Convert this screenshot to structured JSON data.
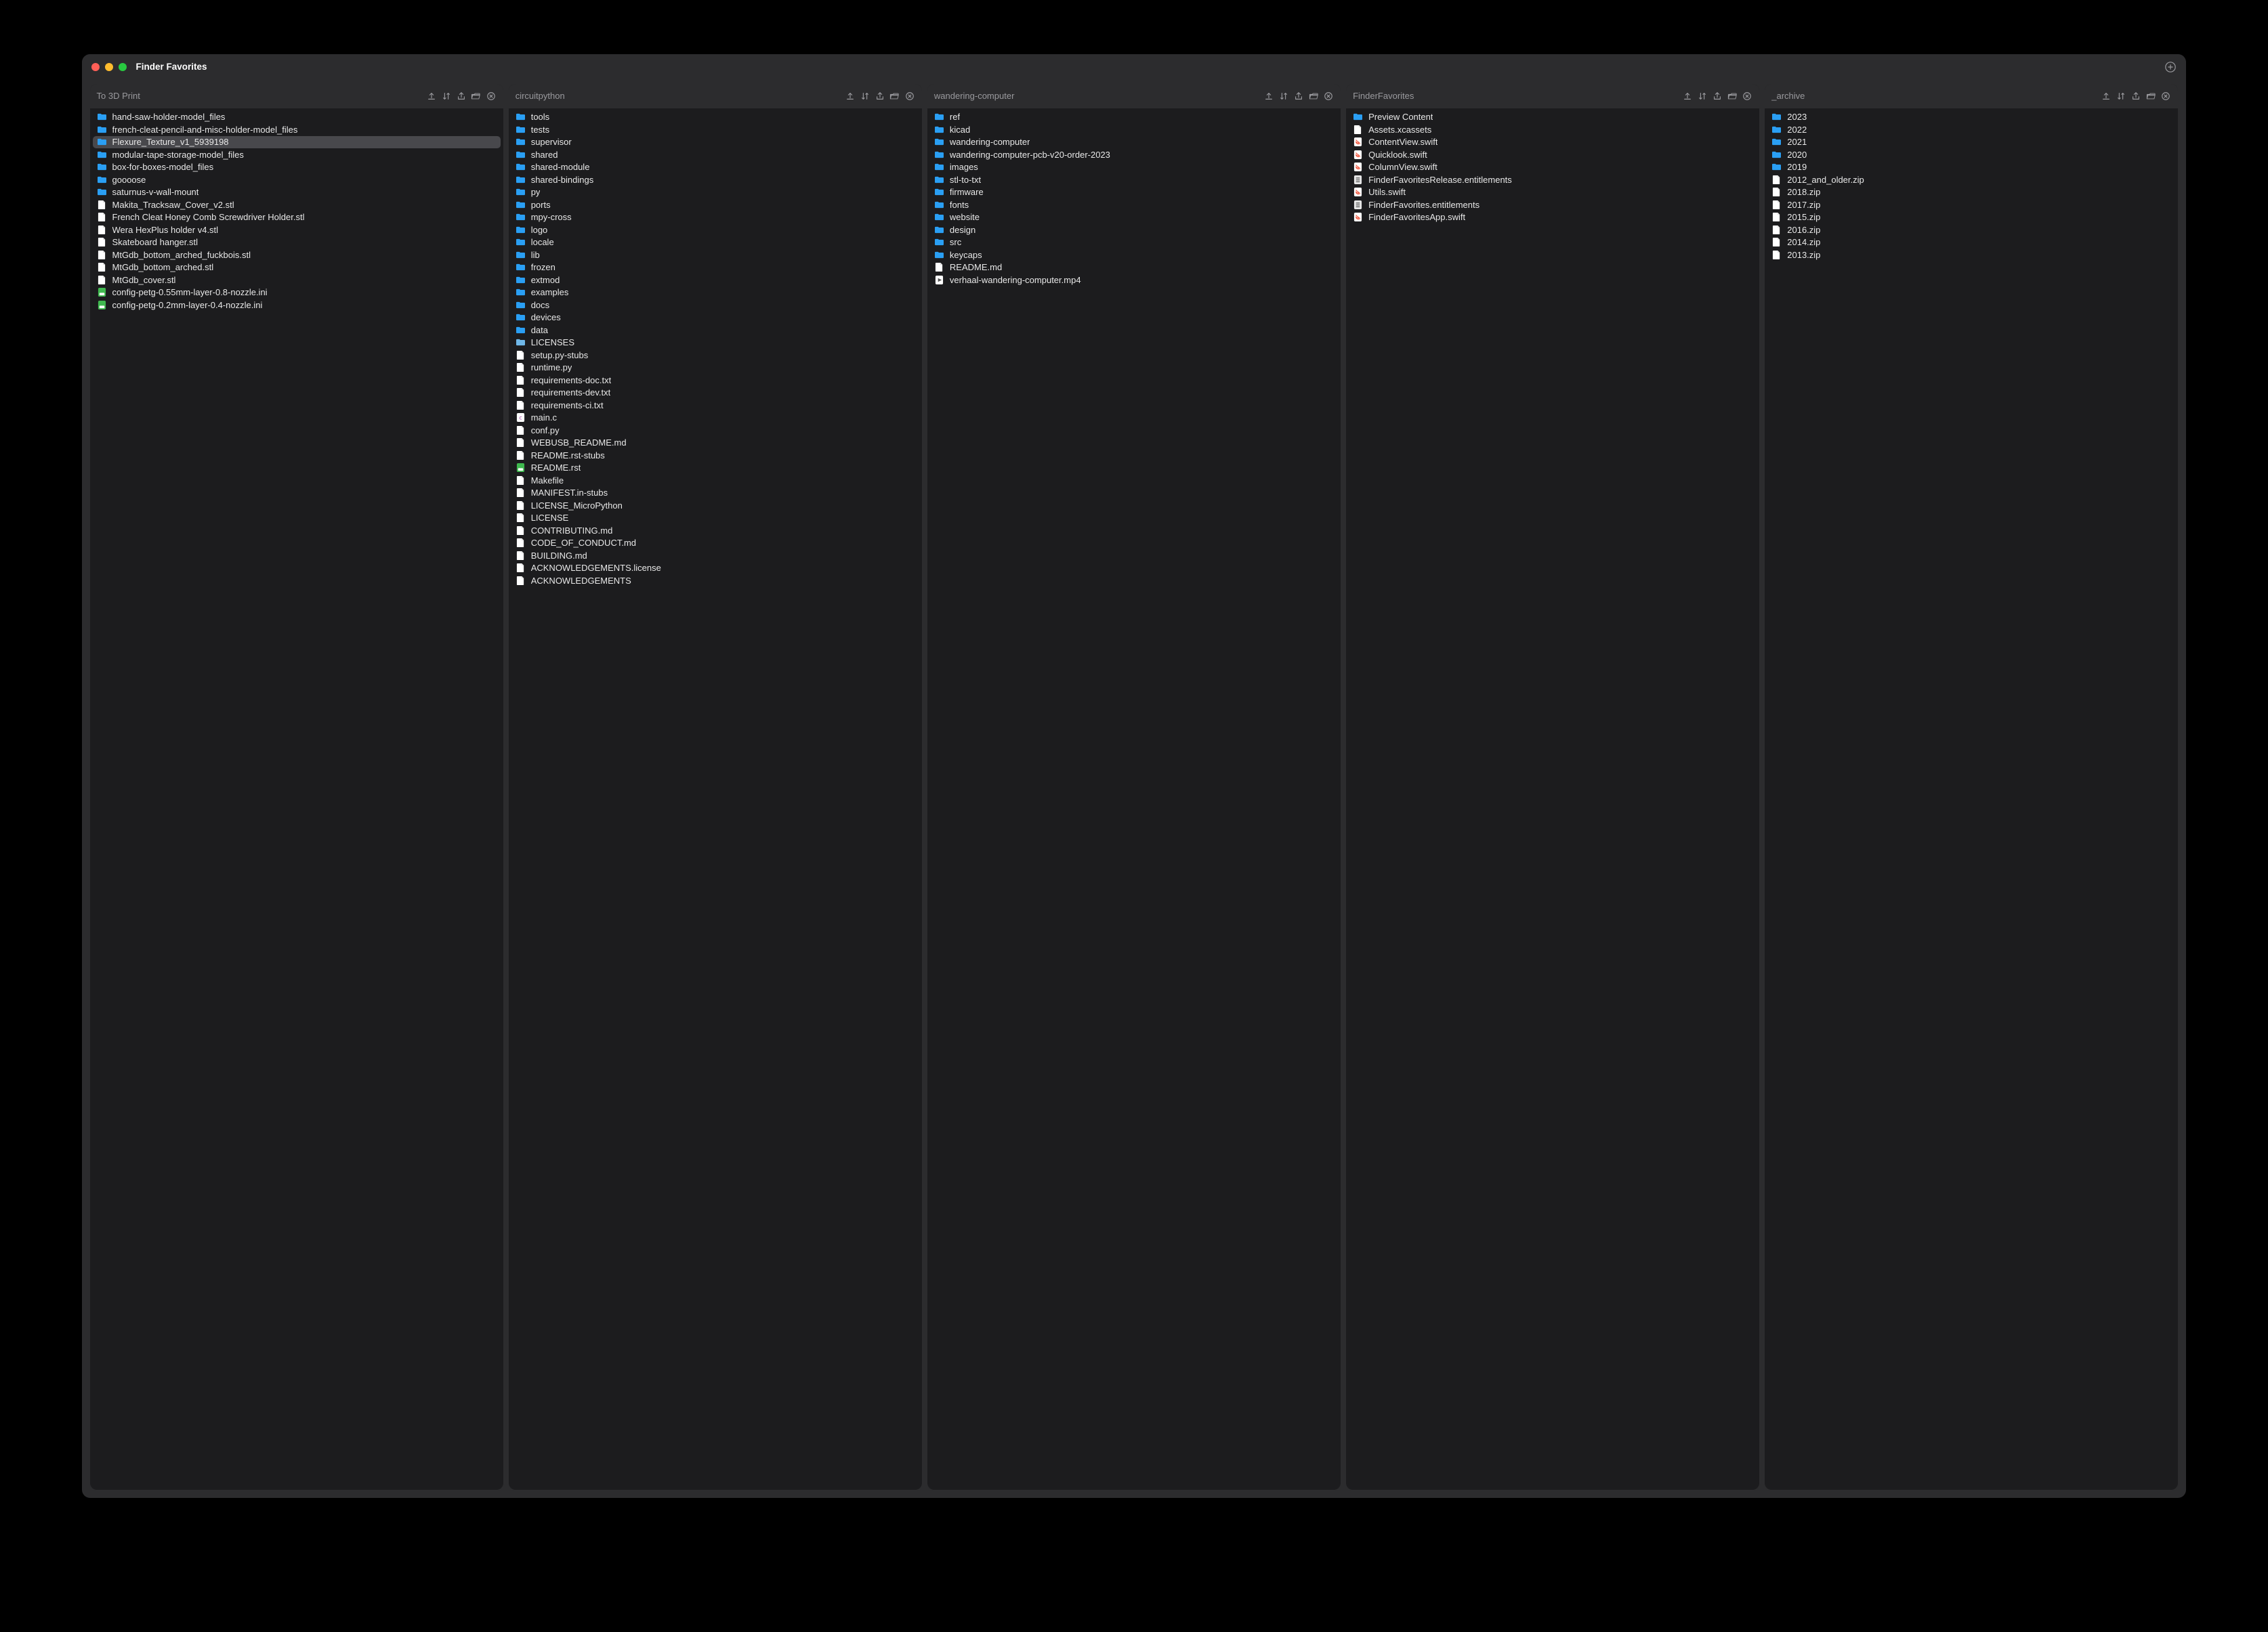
{
  "window": {
    "title": "Finder Favorites"
  },
  "icons": {
    "close": "red",
    "min": "yellow",
    "max": "green"
  },
  "columns": [
    {
      "title": "To 3D Print",
      "items": [
        {
          "icon": "folder",
          "name": "hand-saw-holder-model_files"
        },
        {
          "icon": "folder",
          "name": "french-cleat-pencil-and-misc-holder-model_files"
        },
        {
          "icon": "folder",
          "name": "Flexure_Texture_v1_5939198",
          "selected": true
        },
        {
          "icon": "folder",
          "name": "modular-tape-storage-model_files"
        },
        {
          "icon": "folder",
          "name": "box-for-boxes-model_files"
        },
        {
          "icon": "folder",
          "name": "goooose"
        },
        {
          "icon": "folder",
          "name": "saturnus-v-wall-mount"
        },
        {
          "icon": "file",
          "name": "Makita_Tracksaw_Cover_v2.stl"
        },
        {
          "icon": "file",
          "name": "French Cleat Honey Comb Screwdriver Holder.stl"
        },
        {
          "icon": "file",
          "name": "Wera HexPlus holder v4.stl"
        },
        {
          "icon": "file",
          "name": "Skateboard hanger.stl"
        },
        {
          "icon": "file",
          "name": "MtGdb_bottom_arched_fuckbois.stl"
        },
        {
          "icon": "file",
          "name": "MtGdb_bottom_arched.stl"
        },
        {
          "icon": "file",
          "name": "MtGdb_cover.stl"
        },
        {
          "icon": "ini",
          "name": "config-petg-0.55mm-layer-0.8-nozzle.ini"
        },
        {
          "icon": "ini",
          "name": "config-petg-0.2mm-layer-0.4-nozzle.ini"
        }
      ]
    },
    {
      "title": "circuitpython",
      "items": [
        {
          "icon": "folder",
          "name": "tools"
        },
        {
          "icon": "folder",
          "name": "tests"
        },
        {
          "icon": "folder",
          "name": "supervisor"
        },
        {
          "icon": "folder",
          "name": "shared"
        },
        {
          "icon": "folder",
          "name": "shared-module"
        },
        {
          "icon": "folder",
          "name": "shared-bindings"
        },
        {
          "icon": "folder",
          "name": "py"
        },
        {
          "icon": "folder",
          "name": "ports"
        },
        {
          "icon": "folder",
          "name": "mpy-cross"
        },
        {
          "icon": "folder",
          "name": "logo"
        },
        {
          "icon": "folder",
          "name": "locale"
        },
        {
          "icon": "folder",
          "name": "lib"
        },
        {
          "icon": "folder",
          "name": "frozen"
        },
        {
          "icon": "folder",
          "name": "extmod"
        },
        {
          "icon": "folder",
          "name": "examples"
        },
        {
          "icon": "folder",
          "name": "docs"
        },
        {
          "icon": "folder",
          "name": "devices"
        },
        {
          "icon": "folder",
          "name": "data"
        },
        {
          "icon": "folder-alt",
          "name": "LICENSES"
        },
        {
          "icon": "file",
          "name": "setup.py-stubs"
        },
        {
          "icon": "file",
          "name": "runtime.py"
        },
        {
          "icon": "file",
          "name": "requirements-doc.txt"
        },
        {
          "icon": "file",
          "name": "requirements-dev.txt"
        },
        {
          "icon": "file",
          "name": "requirements-ci.txt"
        },
        {
          "icon": "c",
          "name": "main.c"
        },
        {
          "icon": "file",
          "name": "conf.py"
        },
        {
          "icon": "file",
          "name": "WEBUSB_README.md"
        },
        {
          "icon": "file",
          "name": "README.rst-stubs"
        },
        {
          "icon": "rst",
          "name": "README.rst"
        },
        {
          "icon": "file",
          "name": "Makefile"
        },
        {
          "icon": "file",
          "name": "MANIFEST.in-stubs"
        },
        {
          "icon": "file",
          "name": "LICENSE_MicroPython"
        },
        {
          "icon": "file",
          "name": "LICENSE"
        },
        {
          "icon": "file",
          "name": "CONTRIBUTING.md"
        },
        {
          "icon": "file",
          "name": "CODE_OF_CONDUCT.md"
        },
        {
          "icon": "file",
          "name": "BUILDING.md"
        },
        {
          "icon": "file",
          "name": "ACKNOWLEDGEMENTS.license"
        },
        {
          "icon": "file",
          "name": "ACKNOWLEDGEMENTS"
        }
      ]
    },
    {
      "title": "wandering-computer",
      "items": [
        {
          "icon": "folder",
          "name": "ref"
        },
        {
          "icon": "folder",
          "name": "kicad"
        },
        {
          "icon": "folder",
          "name": "wandering-computer"
        },
        {
          "icon": "folder",
          "name": "wandering-computer-pcb-v20-order-2023"
        },
        {
          "icon": "folder",
          "name": "images"
        },
        {
          "icon": "folder",
          "name": "stl-to-txt"
        },
        {
          "icon": "folder",
          "name": "firmware"
        },
        {
          "icon": "folder",
          "name": "fonts"
        },
        {
          "icon": "folder",
          "name": "website"
        },
        {
          "icon": "folder",
          "name": "design"
        },
        {
          "icon": "folder",
          "name": "src"
        },
        {
          "icon": "folder",
          "name": "keycaps"
        },
        {
          "icon": "file",
          "name": "README.md"
        },
        {
          "icon": "video",
          "name": "verhaal-wandering-computer.mp4"
        }
      ]
    },
    {
      "title": "FinderFavorites",
      "items": [
        {
          "icon": "folder",
          "name": "Preview Content"
        },
        {
          "icon": "file",
          "name": "Assets.xcassets"
        },
        {
          "icon": "swift",
          "name": "ContentView.swift"
        },
        {
          "icon": "swift",
          "name": "Quicklook.swift"
        },
        {
          "icon": "swift",
          "name": "ColumnView.swift"
        },
        {
          "icon": "ent",
          "name": "FinderFavoritesRelease.entitlements"
        },
        {
          "icon": "swift",
          "name": "Utils.swift"
        },
        {
          "icon": "ent",
          "name": "FinderFavorites.entitlements"
        },
        {
          "icon": "swift",
          "name": "FinderFavoritesApp.swift"
        }
      ]
    },
    {
      "title": "_archive",
      "items": [
        {
          "icon": "folder",
          "name": "2023"
        },
        {
          "icon": "folder",
          "name": "2022"
        },
        {
          "icon": "folder",
          "name": "2021"
        },
        {
          "icon": "folder",
          "name": "2020"
        },
        {
          "icon": "folder",
          "name": "2019"
        },
        {
          "icon": "file",
          "name": "2012_and_older.zip"
        },
        {
          "icon": "file",
          "name": "2018.zip"
        },
        {
          "icon": "file",
          "name": "2017.zip"
        },
        {
          "icon": "file",
          "name": "2015.zip"
        },
        {
          "icon": "file",
          "name": "2016.zip"
        },
        {
          "icon": "file",
          "name": "2014.zip"
        },
        {
          "icon": "file",
          "name": "2013.zip"
        }
      ]
    }
  ]
}
